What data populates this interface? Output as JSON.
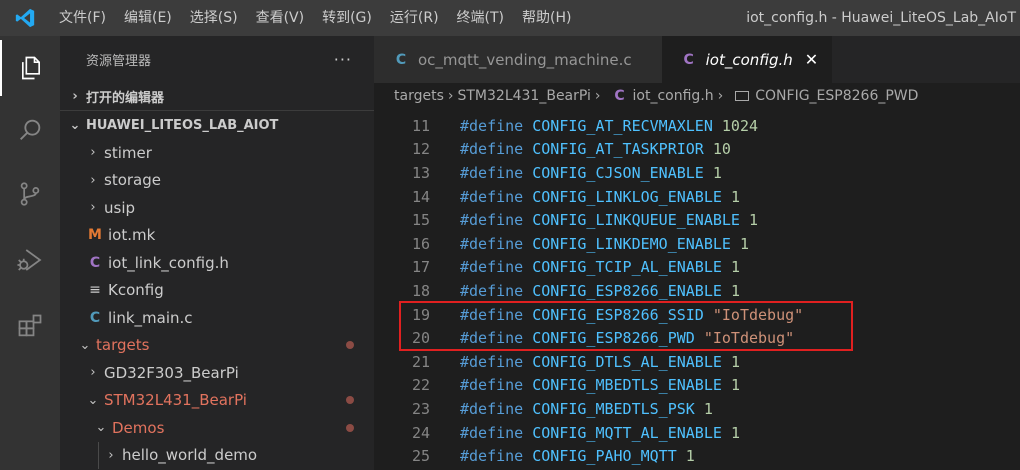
{
  "menu": [
    "文件(F)",
    "编辑(E)",
    "选择(S)",
    "查看(V)",
    "转到(G)",
    "运行(R)",
    "终端(T)",
    "帮助(H)"
  ],
  "window_title": "iot_config.h - Huawei_LiteOS_Lab_AIoT",
  "activity_bar": [
    "explorer-icon",
    "search-icon",
    "source-control-icon",
    "run-debug-icon",
    "extensions-icon"
  ],
  "sidebar": {
    "title": "资源管理器",
    "more": "···",
    "open_editors": "打开的编辑器",
    "project": "HUAWEI_LITEOS_LAB_AIOT",
    "tree": [
      {
        "label": "stimer",
        "chev": "›",
        "icon": "",
        "modified": false
      },
      {
        "label": "storage",
        "chev": "›",
        "icon": "",
        "modified": false
      },
      {
        "label": "usip",
        "chev": "›",
        "icon": "",
        "modified": false
      },
      {
        "label": "iot.mk",
        "chev": "",
        "icon": "M",
        "modified": false
      },
      {
        "label": "iot_link_config.h",
        "chev": "",
        "icon": "C",
        "modified": false
      },
      {
        "label": "Kconfig",
        "chev": "",
        "icon": "≡",
        "modified": false
      },
      {
        "label": "link_main.c",
        "chev": "",
        "icon": "C",
        "modified": false
      },
      {
        "label": "targets",
        "chev": "⌄",
        "icon": "",
        "modified": true
      },
      {
        "label": "GD32F303_BearPi",
        "chev": "›",
        "icon": "",
        "modified": false
      },
      {
        "label": "STM32L431_BearPi",
        "chev": "⌄",
        "icon": "",
        "modified": true
      },
      {
        "label": "Demos",
        "chev": "⌄",
        "icon": "",
        "modified": true
      },
      {
        "label": "hello_world_demo",
        "chev": "›",
        "icon": "",
        "modified": false
      }
    ]
  },
  "tabs": [
    {
      "icon": "C",
      "label": "oc_mqtt_vending_machine.c",
      "active": false
    },
    {
      "icon": "C",
      "label": "iot_config.h",
      "active": true,
      "close": "✕"
    }
  ],
  "breadcrumb": {
    "parts": [
      "targets",
      "STM32L431_BearPi"
    ],
    "file_icon": "C",
    "file": "iot_config.h",
    "symbol": "CONFIG_ESP8266_PWD",
    "sep": "›"
  },
  "code_lines": [
    {
      "n": "11",
      "kw": "#define",
      "name": "CONFIG_AT_RECVMAXLEN",
      "val": "1024",
      "type": "num"
    },
    {
      "n": "12",
      "kw": "#define",
      "name": "CONFIG_AT_TASKPRIOR",
      "val": "10",
      "type": "num"
    },
    {
      "n": "13",
      "kw": "#define",
      "name": "CONFIG_CJSON_ENABLE",
      "val": "1",
      "type": "num"
    },
    {
      "n": "14",
      "kw": "#define",
      "name": "CONFIG_LINKLOG_ENABLE",
      "val": "1",
      "type": "num"
    },
    {
      "n": "15",
      "kw": "#define",
      "name": "CONFIG_LINKQUEUE_ENABLE",
      "val": "1",
      "type": "num"
    },
    {
      "n": "16",
      "kw": "#define",
      "name": "CONFIG_LINKDEMO_ENABLE",
      "val": "1",
      "type": "num"
    },
    {
      "n": "17",
      "kw": "#define",
      "name": "CONFIG_TCIP_AL_ENABLE",
      "val": "1",
      "type": "num"
    },
    {
      "n": "18",
      "kw": "#define",
      "name": "CONFIG_ESP8266_ENABLE",
      "val": "1",
      "type": "num"
    },
    {
      "n": "19",
      "kw": "#define",
      "name": "CONFIG_ESP8266_SSID",
      "val": "\"IoTdebug\"",
      "type": "str"
    },
    {
      "n": "20",
      "kw": "#define",
      "name": "CONFIG_ESP8266_PWD",
      "val": "\"IoTdebug\"",
      "type": "str"
    },
    {
      "n": "21",
      "kw": "#define",
      "name": "CONFIG_DTLS_AL_ENABLE",
      "val": "1",
      "type": "num"
    },
    {
      "n": "22",
      "kw": "#define",
      "name": "CONFIG_MBEDTLS_ENABLE",
      "val": "1",
      "type": "num"
    },
    {
      "n": "23",
      "kw": "#define",
      "name": "CONFIG_MBEDTLS_PSK",
      "val": "1",
      "type": "num"
    },
    {
      "n": "24",
      "kw": "#define",
      "name": "CONFIG_MQTT_AL_ENABLE",
      "val": "1",
      "type": "num"
    },
    {
      "n": "25",
      "kw": "#define",
      "name": "CONFIG_PAHO_MQTT",
      "val": "1",
      "type": "num"
    }
  ],
  "colors": {
    "accent_highlight": "#e02020",
    "modified_text": "#e2735e",
    "keyword": "#569cd6",
    "number": "#b5cea8",
    "string": "#ce9178"
  }
}
